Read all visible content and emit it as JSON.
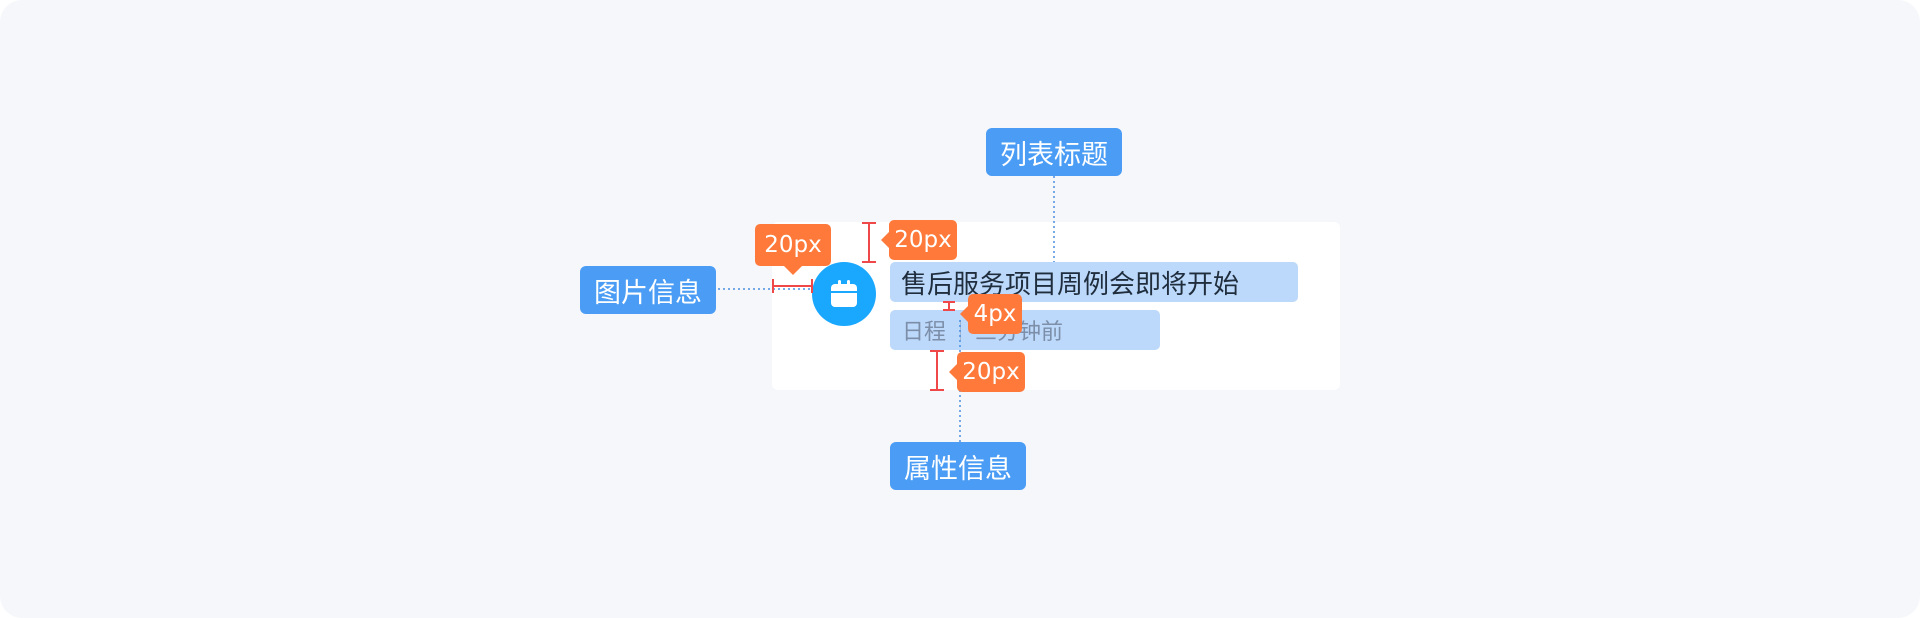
{
  "colors": {
    "canvas_bg": "#f5f7fa",
    "card_bg": "#ffffff",
    "label_blue": "#4a9cf5",
    "highlight_blue": "#bcd9fb",
    "icon_blue": "#1aa8ff",
    "tag_orange": "#ff7a3a",
    "measure_red": "#f04848",
    "guide_blue": "#4a8fe0"
  },
  "icon": "calendar-icon",
  "card": {
    "title": "售后服务项目周例会即将开始",
    "attr_type": "日程",
    "attr_time": "三分钟前"
  },
  "labels": {
    "list_title": "列表标题",
    "image_info": "图片信息",
    "attr_info": "属性信息"
  },
  "measurements": {
    "top_padding": "20px",
    "left_padding": "20px",
    "line_gap": "4px",
    "bottom_padding": "20px"
  }
}
